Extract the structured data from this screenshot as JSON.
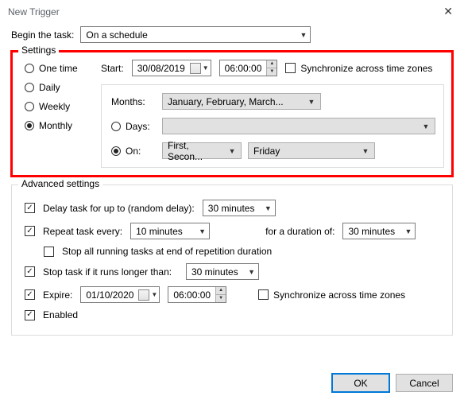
{
  "title": "New Trigger",
  "begin_label": "Begin the task:",
  "begin_value": "On a schedule",
  "settings": {
    "title": "Settings",
    "schedule": {
      "one_time": "One time",
      "daily": "Daily",
      "weekly": "Weekly",
      "monthly": "Monthly"
    },
    "start_label": "Start:",
    "start_date": "30/08/2019",
    "start_time": "06:00:00",
    "sync_label": "Synchronize across time zones",
    "months_label": "Months:",
    "months_value": "January, February, March...",
    "days_label": "Days:",
    "on_label": "On:",
    "on_week": "First, Secon...",
    "on_day": "Friday"
  },
  "advanced": {
    "title": "Advanced settings",
    "delay_label": "Delay task for up to (random delay):",
    "delay_value": "30 minutes",
    "repeat_label": "Repeat task every:",
    "repeat_value": "10 minutes",
    "duration_label": "for a duration of:",
    "duration_value": "30 minutes",
    "stop_all_label": "Stop all running tasks at end of repetition duration",
    "stop_longer_label": "Stop task if it runs longer than:",
    "stop_longer_value": "30 minutes",
    "expire_label": "Expire:",
    "expire_date": "01/10/2020",
    "expire_time": "06:00:00",
    "sync2_label": "Synchronize across time zones",
    "enabled_label": "Enabled"
  },
  "buttons": {
    "ok": "OK",
    "cancel": "Cancel"
  }
}
